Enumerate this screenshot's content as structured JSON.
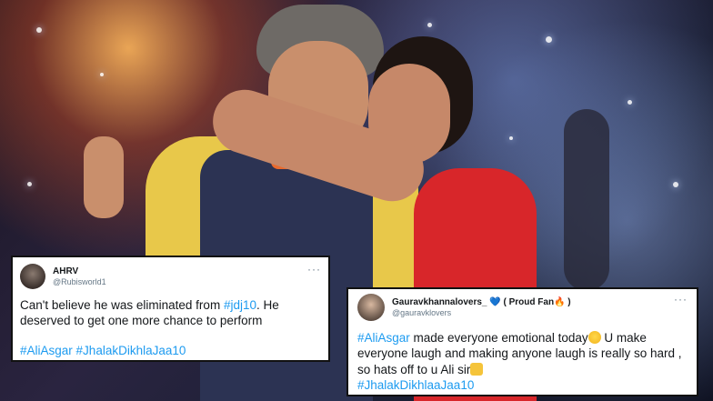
{
  "tweet1": {
    "display_name": "AHRV",
    "handle": "@Rubisworld1",
    "more_label": "···",
    "text_part1": "Can't believe he was eliminated from ",
    "hashtag_inline": "#jdj10",
    "text_part2": ". He deserved to get one more chance to perform",
    "hashtags": [
      "#AliAsgar",
      "#JhalakDikhlaJaa10"
    ]
  },
  "tweet2": {
    "display_name": "Gauravkhannalovers_",
    "heart_glyph": "💙",
    "name_suffix_open": " ( Proud Fan",
    "fire_glyph": "🔥",
    "name_suffix_close": " )",
    "handle": "@gauravklovers",
    "more_label": "···",
    "hashtag_lead": "#AliAsgar",
    "text_part1": " made everyone emotional today",
    "text_part2": " U make everyone laugh and making anyone laugh is really so hard , so hats off to u Ali sir",
    "hashtag_tail": "#JhalakDikhlaaJaa10"
  },
  "colors": {
    "link": "#1d9bf0",
    "tweet_bg": "#ffffff",
    "border": "#111111"
  }
}
